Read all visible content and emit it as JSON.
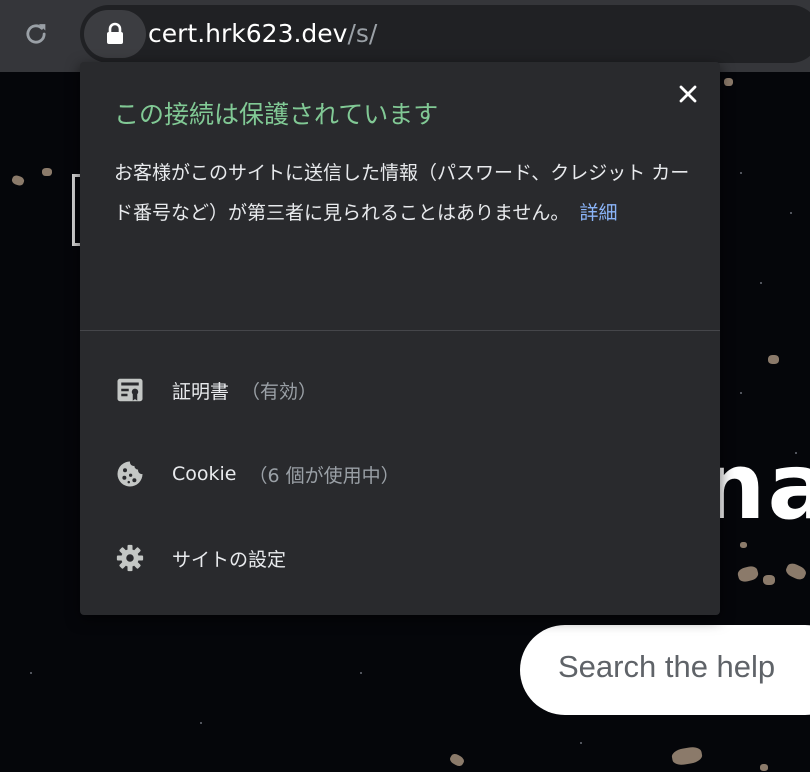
{
  "toolbar": {
    "url_host": "cert.hrk623.dev",
    "url_path": "/s/"
  },
  "page": {
    "big_text": "na",
    "search_placeholder": "Search the help"
  },
  "popup": {
    "title": "この接続は保護されています",
    "description": "お客様がこのサイトに送信した情報（パスワード、クレジット カード番号など）が第三者に見られることはありません。",
    "details_link": "詳細",
    "items": [
      {
        "label": "証明書",
        "sub": "（有効）",
        "icon": "certificate-icon"
      },
      {
        "label": "Cookie",
        "sub": "（6 個が使用中）",
        "icon": "cookie-icon"
      },
      {
        "label": "サイトの設定",
        "sub": "",
        "icon": "gear-icon"
      }
    ]
  },
  "colors": {
    "title_green": "#81c995",
    "link_blue": "#8ab4f8",
    "popup_bg": "#292a2d",
    "toolbar_bg": "#35363a"
  }
}
